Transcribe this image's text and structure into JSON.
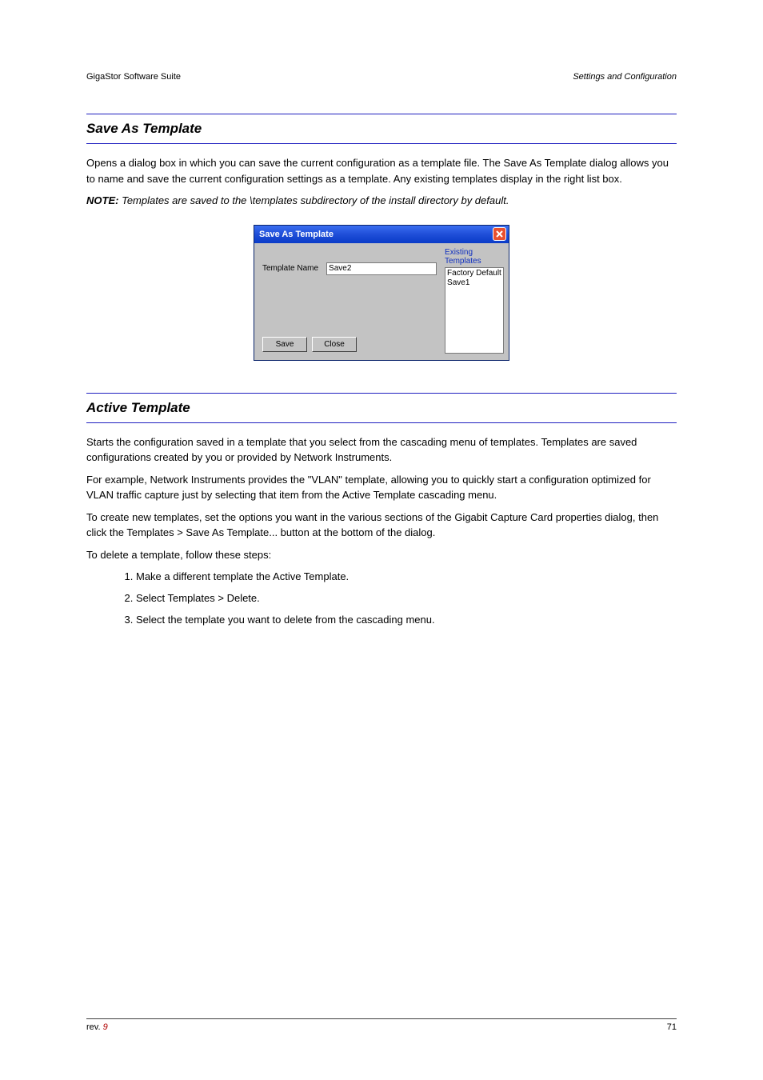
{
  "header": {
    "left": "GigaStor Software Suite",
    "right": "Settings and Configuration"
  },
  "section1": {
    "heading": "Save As Template",
    "p1": "Opens a dialog box in which you can save the current configuration as a template file. The Save As Template dialog allows you to name and save the current configuration settings as a template. Any existing templates display in the right list box.",
    "p2_label": "NOTE:",
    "p2_body": " Templates are saved to the \\templates subdirectory of the install directory by default."
  },
  "dialog": {
    "title": "Save As Template",
    "field_label": "Template Name",
    "field_value": "Save2",
    "save_label": "Save",
    "close_label": "Close",
    "existing_label": "Existing Templates",
    "existing_items": [
      "Factory Default",
      "Save1"
    ]
  },
  "section2": {
    "heading": "Active Template",
    "p1": "Starts the configuration saved in a template that you select from the cascading menu of templates. Templates are saved configurations created by you or provided by Network Instruments.",
    "p2": "For example, Network Instruments provides the \"VLAN\" template, allowing you to quickly start a configuration optimized for VLAN traffic capture just by selecting that item from the Active Template cascading menu.",
    "p3": "To create new templates, set the options you want in the various sections of the Gigabit Capture Card properties dialog, then click the Templates > Save As Template... button at the bottom of the dialog.",
    "p4": "To delete a template, follow these steps:",
    "steps": [
      "Make a different template the Active Template.",
      "Select Templates > Delete.",
      "Select the template you want to delete from the cascading menu."
    ]
  },
  "footer": {
    "left_prefix": "rev. ",
    "left_rev": "9",
    "right": "71"
  }
}
